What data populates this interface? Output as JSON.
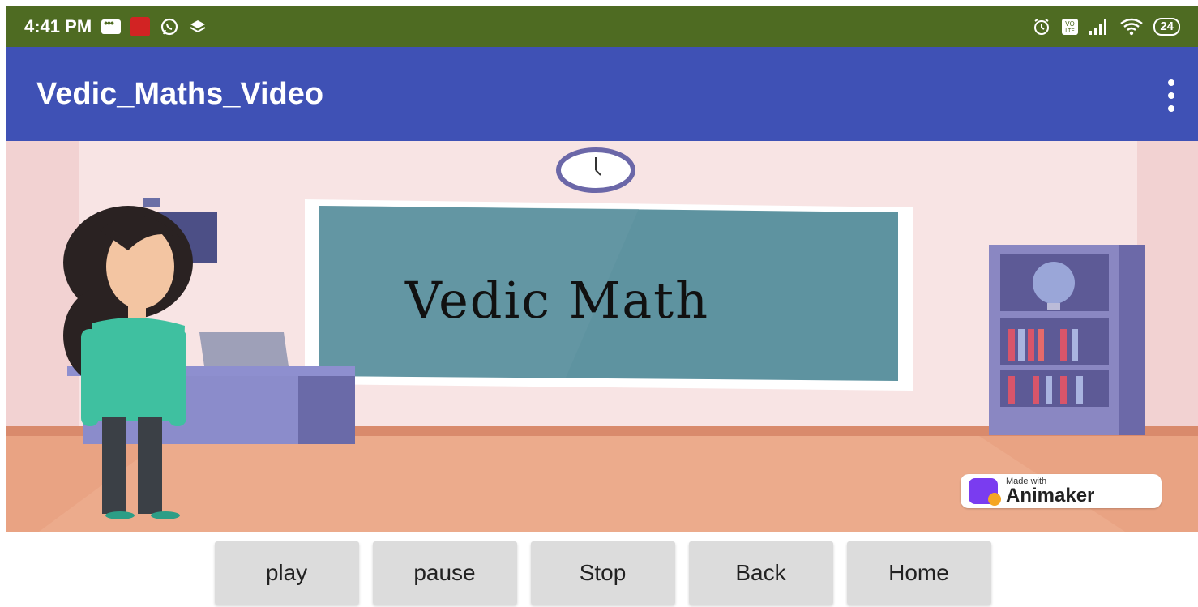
{
  "status_bar": {
    "time": "4:41 PM",
    "battery": "24",
    "background_color": "#4e6b22",
    "left_icons": [
      "message-icon",
      "app-notification-icon",
      "whatsapp-icon",
      "layers-icon"
    ],
    "right_icons": [
      "alarm-icon",
      "volte-icon",
      "signal-icon",
      "wifi-icon",
      "battery-icon"
    ]
  },
  "app_bar": {
    "title": "Vedic_Maths_Video",
    "background_color": "#3f51b5",
    "menu_icon": "overflow-menu-icon"
  },
  "video": {
    "board_text": "Vedic Math",
    "badge_small": "Made with",
    "badge_big": "Animaker"
  },
  "controls": {
    "play": "play",
    "pause": "pause",
    "stop": "Stop",
    "back": "Back",
    "home": "Home"
  }
}
